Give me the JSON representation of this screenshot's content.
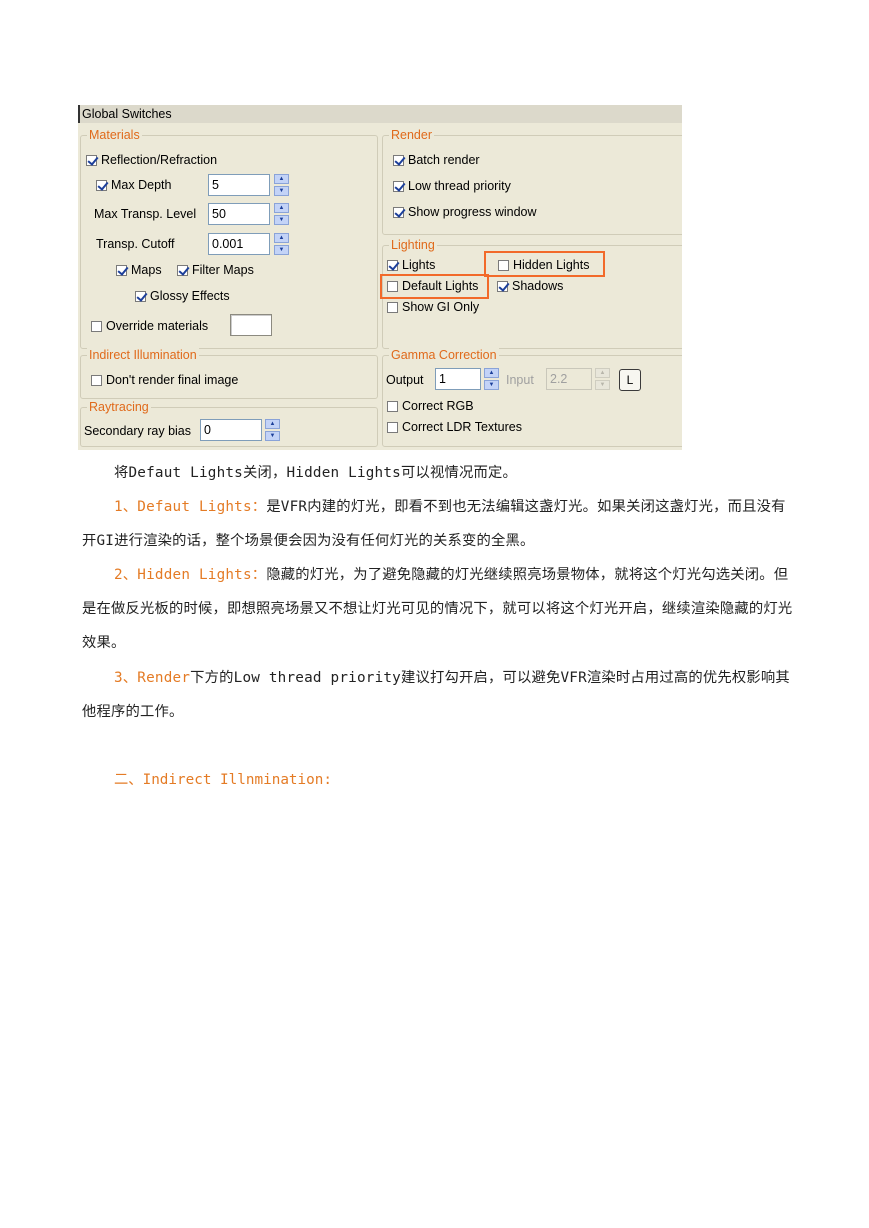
{
  "panel": {
    "title": "Global Switches",
    "materials": {
      "legend": "Materials",
      "reflection": "Reflection/Refraction",
      "max_depth_label": "Max Depth",
      "max_depth_value": "5",
      "max_transp_label": "Max Transp. Level",
      "max_transp_value": "50",
      "transp_cutoff_label": "Transp. Cutoff",
      "transp_cutoff_value": "0.001",
      "maps": "Maps",
      "filter_maps": "Filter Maps",
      "glossy": "Glossy Effects",
      "override": "Override materials"
    },
    "render": {
      "legend": "Render",
      "batch": "Batch render",
      "low_thread": "Low thread priority",
      "show_progress": "Show progress window"
    },
    "lighting": {
      "legend": "Lighting",
      "lights": "Lights",
      "hidden_lights": "Hidden Lights",
      "default_lights": "Default Lights",
      "shadows": "Shadows",
      "show_gi": "Show GI Only"
    },
    "indirect": {
      "legend": "Indirect Illumination",
      "dont_render": "Don't render final image"
    },
    "raytracing": {
      "legend": "Raytracing",
      "bias_label": "Secondary ray bias",
      "bias_value": "0"
    },
    "gamma": {
      "legend": "Gamma Correction",
      "output_label": "Output",
      "output_value": "1",
      "input_label": "Input",
      "input_value": "2.2",
      "lock_label": "L",
      "correct_rgb": "Correct RGB",
      "correct_ldr": "Correct LDR Textures"
    },
    "colors": {
      "accent": "#e06a1b",
      "highlight": "#f26a2a",
      "panel_bg": "#ece9d8"
    }
  },
  "body": {
    "p0": "将Defaut Lights关闭，Hidden Lights可以视情况而定。",
    "p1_term": "1、Defaut Lights：",
    "p1_text": "是VFR内建的灯光，即看不到也无法编辑这盏灯光。如果关闭这盏灯光，而且没有开GI进行渲染的话，整个场景便会因为没有任何灯光的关系变的全黑。",
    "p2_term": "2、Hidden Lights：",
    "p2_text": "隐藏的灯光，为了避免隐藏的灯光继续照亮场景物体，就将这个灯光勾选关闭。但是在做反光板的时候，即想照亮场景又不想让灯光可见的情况下，就可以将这个灯光开启，继续渲染隐藏的灯光效果。",
    "p3_term": "3、Render",
    "p3_text": "下方的Low thread priority建议打勾开启，可以避免VFR渲染时占用过高的优先权影响其他程序的工作。",
    "heading": "二、Indirect Illnmination:"
  }
}
